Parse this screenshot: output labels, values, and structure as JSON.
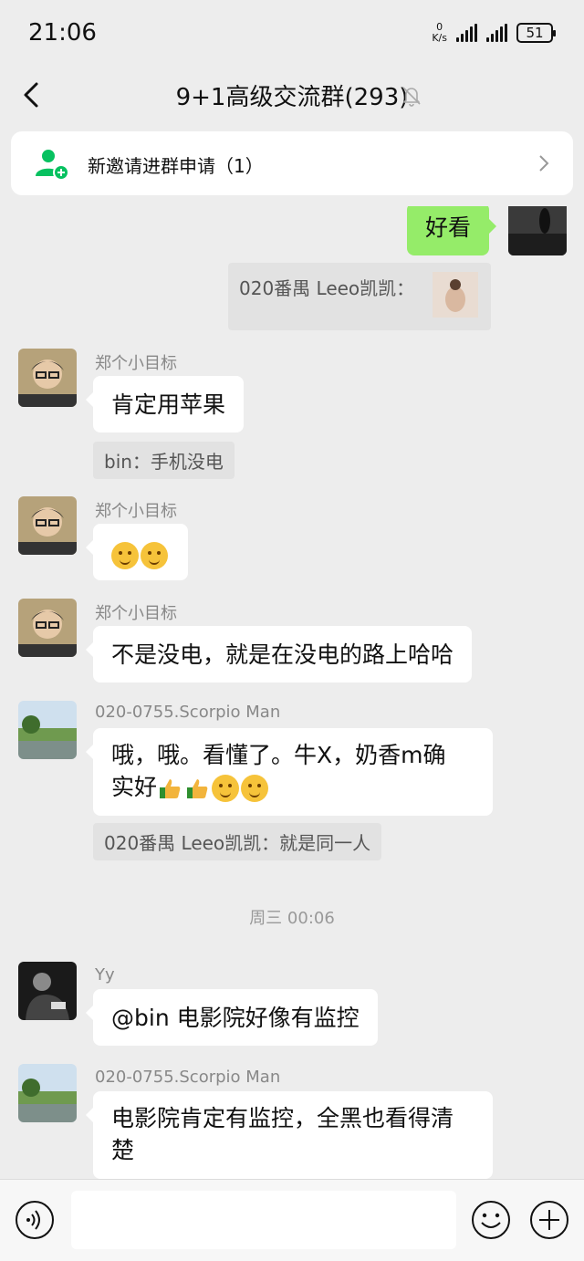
{
  "status_bar": {
    "time": "21:06",
    "net_speed_value": "0",
    "net_speed_unit": "K/s",
    "battery": "51"
  },
  "header": {
    "title": "9+1高级交流群(293)"
  },
  "invite_card": {
    "text": "新邀请进群申请（1）"
  },
  "messages": {
    "m0": {
      "text": "好看"
    },
    "m0_quote": {
      "text": "020番禺 Leeo凯凯："
    },
    "m1": {
      "sender": "郑个小目标",
      "text": "肯定用苹果"
    },
    "m1_quote": {
      "text": "bin：手机没电"
    },
    "m2": {
      "sender": "郑个小目标"
    },
    "m3": {
      "sender": "郑个小目标",
      "text": "不是没电，就是在没电的路上哈哈"
    },
    "m4": {
      "sender": "020-0755.Scorpio Man",
      "line1": "哦，哦。看懂了。牛X，奶香m确",
      "line2": "实好"
    },
    "m4_quote": {
      "text": "020番禺 Leeo凯凯：就是同一人"
    },
    "time_divider": "周三 00:06",
    "m5": {
      "sender": "Yy",
      "text": "@bin  电影院好像有监控"
    },
    "m6": {
      "sender": "020-0755.Scorpio Man",
      "line1": "电影院肯定有监控，全黑也看得清",
      "line2": "楚"
    }
  },
  "input_bar": {
    "placeholder": ""
  },
  "colors": {
    "background": "#ededed",
    "my_bubble": "#95ec69",
    "brand_green": "#07c160"
  },
  "icons": {
    "back": "back-arrow-icon",
    "mute": "mute-bell-icon",
    "invite": "group-invite-icon",
    "voice": "voice-icon",
    "emoji": "emoji-icon",
    "plus": "plus-icon"
  }
}
